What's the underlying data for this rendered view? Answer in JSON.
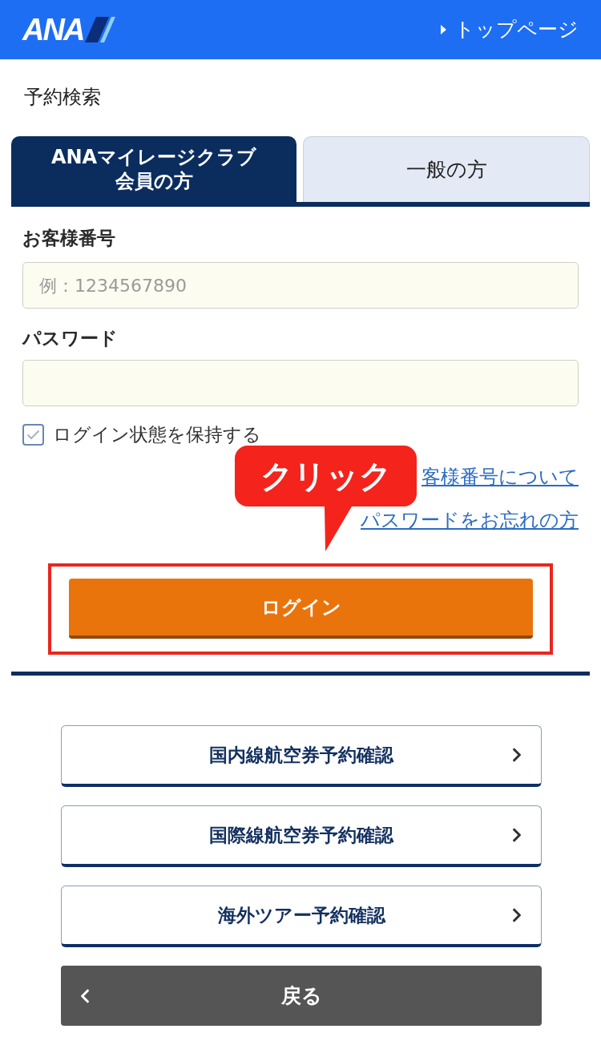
{
  "header": {
    "logo_text": "ANA",
    "top_link": "トップページ"
  },
  "title": "予約検索",
  "tabs": [
    {
      "label_lines": [
        "ANAマイレージクラブ",
        "会員の方"
      ],
      "selected": true
    },
    {
      "label_lines": [
        "一般の方"
      ],
      "selected": false
    }
  ],
  "fields": [
    {
      "label": "お客様番号",
      "placeholder": "例：1234567890"
    },
    {
      "label": "パスワード"
    }
  ],
  "remember": {
    "label": "ログイン状態を保持する",
    "checked": true
  },
  "links": [
    "客様番号について",
    "パスワードをお忘れの方"
  ],
  "callout": {
    "text": "クリック"
  },
  "login_button": {
    "label": "ログイン"
  },
  "menu_buttons": [
    {
      "label": "国内線航空券予約確認"
    },
    {
      "label": "国際線航空券予約確認"
    },
    {
      "label": "海外ツアー予約確認"
    }
  ],
  "back_button": {
    "label": "戻る"
  }
}
